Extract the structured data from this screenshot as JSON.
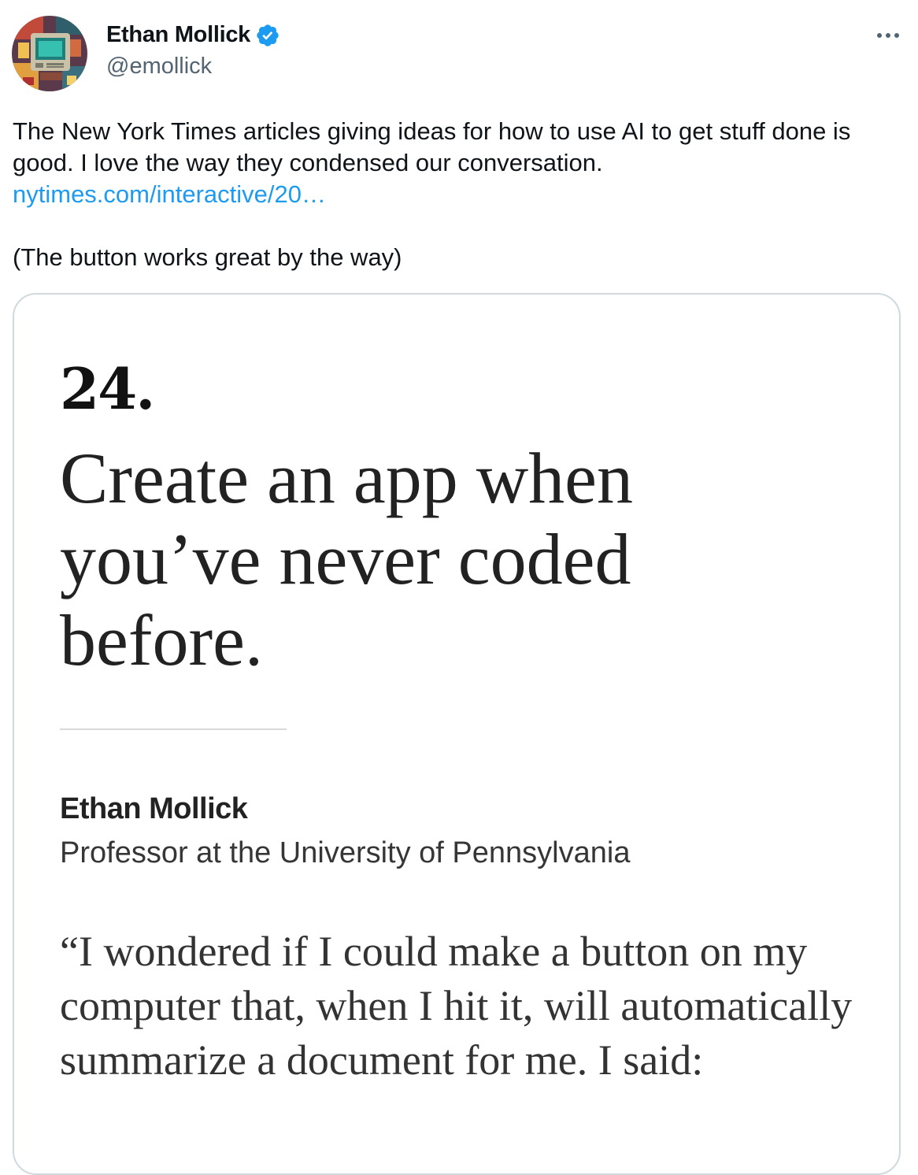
{
  "author": {
    "name": "Ethan Mollick",
    "handle": "@emollick",
    "verified": true,
    "avatar_icon": "pixel-art-retro-computer-avatar"
  },
  "menu": {
    "icon": "more-horizontal-icon"
  },
  "tweet": {
    "line1": "The New York Times articles giving ideas for how to use AI to get stuff done is good. I love the way they condensed our conversation.",
    "link_text": "nytimes.com/interactive/20…",
    "line2": "(The button works great by the way)"
  },
  "card": {
    "number": "24.",
    "title": "Create an app when you’ve never coded before.",
    "byline_name": "Ethan Mollick",
    "byline_role": "Professor at the University of Pennsylvania",
    "quote": "“I wondered if I could make a button on my computer that, when I hit it, will automatically summarize a document for me. I said:"
  },
  "colors": {
    "text": "#0f1419",
    "secondary": "#536471",
    "link": "#1d9bf0",
    "verified": "#1d9bf0",
    "card_border": "#cfd9de"
  }
}
